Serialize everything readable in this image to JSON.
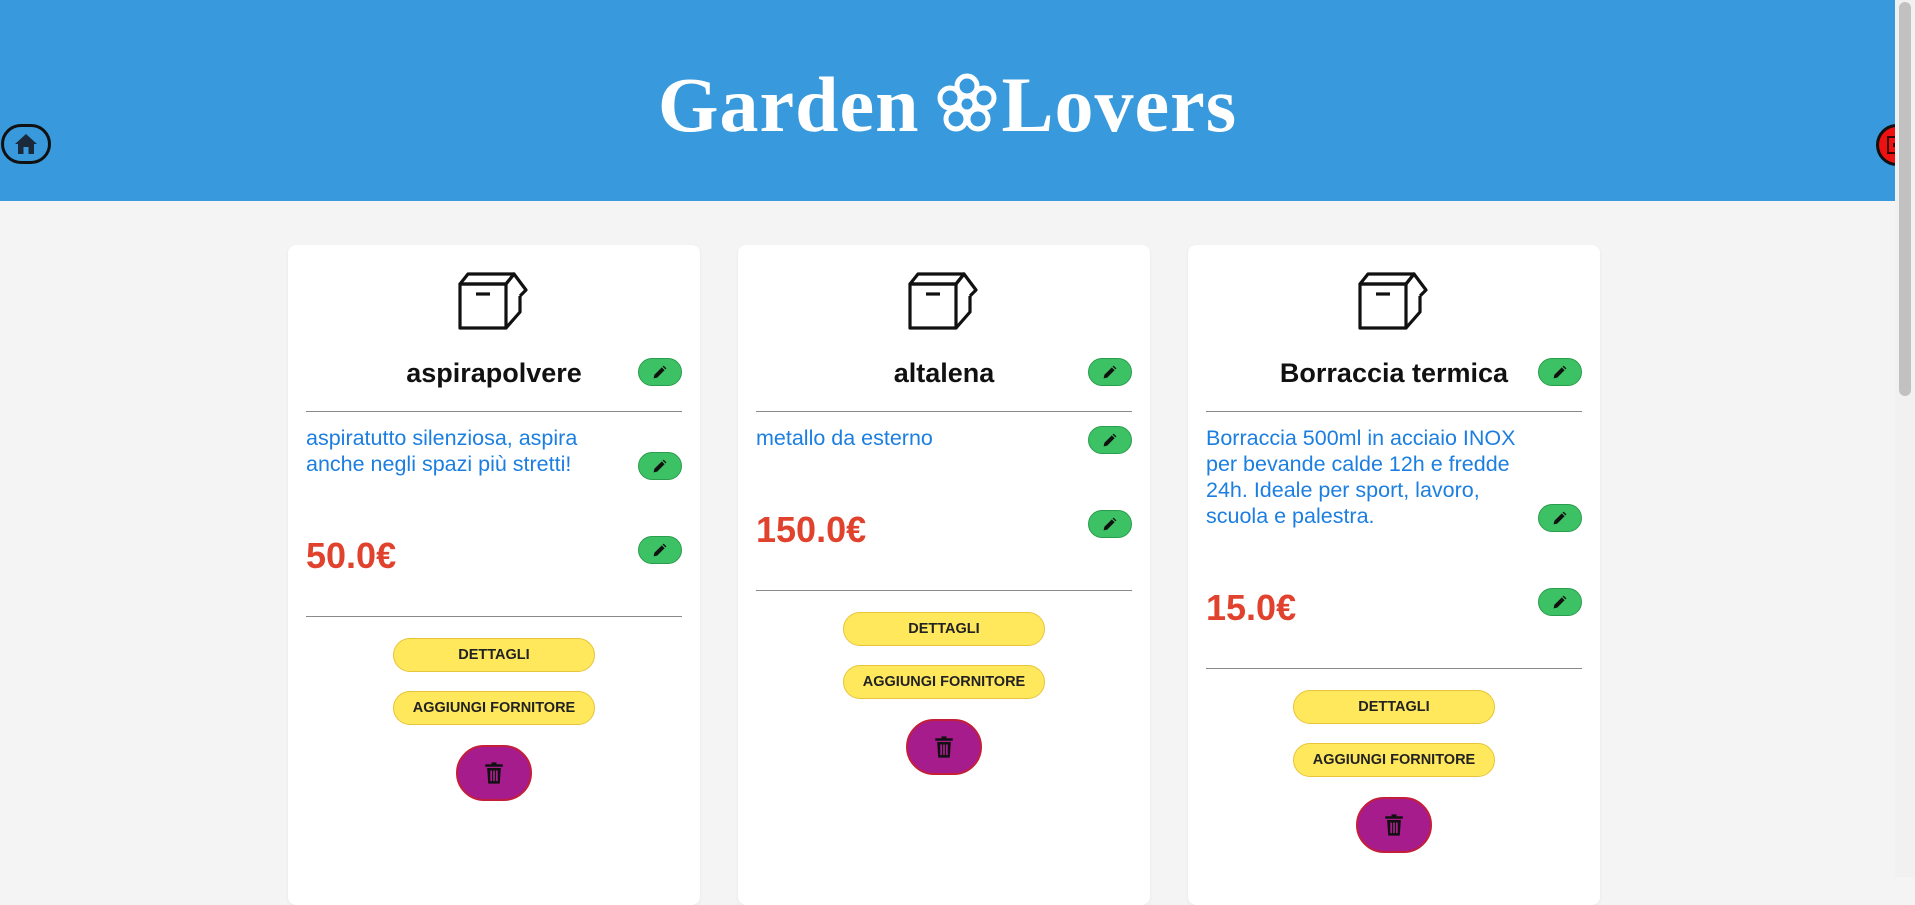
{
  "header": {
    "title_left": "Garden",
    "title_right": "Lovers",
    "flower_icon": "flower-icon",
    "home_icon": "home-icon",
    "logout_icon": "logout-icon",
    "background_color": "#3899dc"
  },
  "products": [
    {
      "name": "aspirapolvere",
      "description": "aspiratutto silenziosa, aspira anche negli spazi più stretti!",
      "price": "50.0€",
      "details_label": "DETTAGLI",
      "add_supplier_label": "AGGIUNGI FORNITORE"
    },
    {
      "name": "altalena",
      "description": "metallo da esterno",
      "price": "150.0€",
      "details_label": "DETTAGLI",
      "add_supplier_label": "AGGIUNGI FORNITORE"
    },
    {
      "name": "Borraccia termica",
      "description": "Borraccia 500ml in acciaio INOX per bevande calde 12h e fredde 24h. Ideale per sport, lavoro, scuola e palestra.",
      "price": "15.0€",
      "details_label": "DETTAGLI",
      "add_supplier_label": "AGGIUNGI FORNITORE"
    }
  ],
  "colors": {
    "edit_button": "#3cc164",
    "action_button": "#ffe85c",
    "delete_button": "#a61c8c",
    "price": "#e0422e",
    "description": "#1c7fe0"
  }
}
